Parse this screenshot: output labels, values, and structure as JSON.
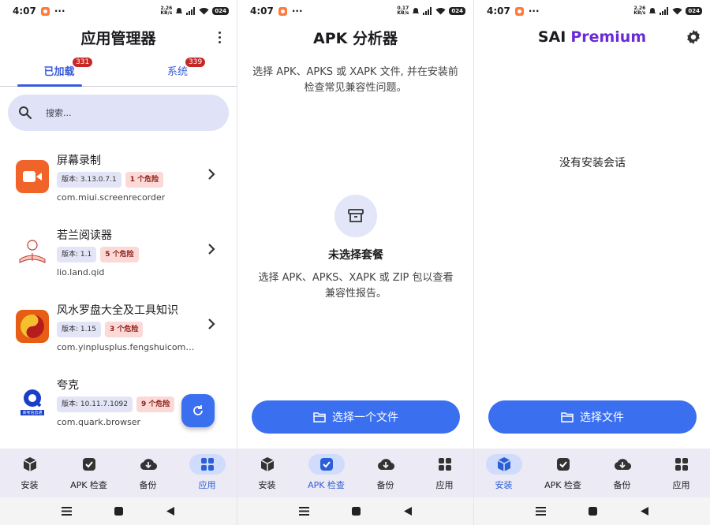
{
  "status": {
    "time": "4:07",
    "dots": "···",
    "speed1": "2.26",
    "speed2": "0.17",
    "speed_unit": "KB/s",
    "battery": "024"
  },
  "screen1": {
    "title": "应用管理器",
    "tabs": [
      {
        "label": "已加载",
        "count": "331"
      },
      {
        "label": "系统",
        "count": "339"
      }
    ],
    "search_placeholder": "搜索...",
    "apps": [
      {
        "name": "屏幕录制",
        "version": "版本: 3.13.0.7.1",
        "risk": "1 个危险",
        "package": "com.miui.screenrecorder"
      },
      {
        "name": "若兰阅读器",
        "version": "版本: 1.1",
        "risk": "5 个危险",
        "package": "lio.land.qid"
      },
      {
        "name": "风水罗盘大全及工具知识",
        "version": "版本: 1.15",
        "risk": "3 个危险",
        "package": "com.yinplusplus.fengshuicompass"
      },
      {
        "name": "夸克",
        "version": "版本: 10.11.7.1092",
        "risk": "9 个危险",
        "package": "com.quark.browser"
      }
    ],
    "quark_icon_text": "高考信息通"
  },
  "screen2": {
    "title": "APK 分析器",
    "desc": "选择 APK、APKS 或 XAPK 文件, 并在安装前检查常见兼容性问题。",
    "empty_title": "未选择套餐",
    "empty_desc": "选择 APK、APKS、XAPK 或 ZIP 包以查看兼容性报告。",
    "button": "选择一个文件"
  },
  "screen3": {
    "title_a": "SAI",
    "title_b": "Premium",
    "no_session": "没有安装会话",
    "button": "选择文件"
  },
  "nav": {
    "install": "安装",
    "apk_check": "APK 检查",
    "backup": "备份",
    "apps": "应用"
  },
  "colors": {
    "accent": "#3a6ff0",
    "danger_bg": "#fbd9d6",
    "premium": "#6a2ad6",
    "nav_bg": "#eceaf4"
  }
}
